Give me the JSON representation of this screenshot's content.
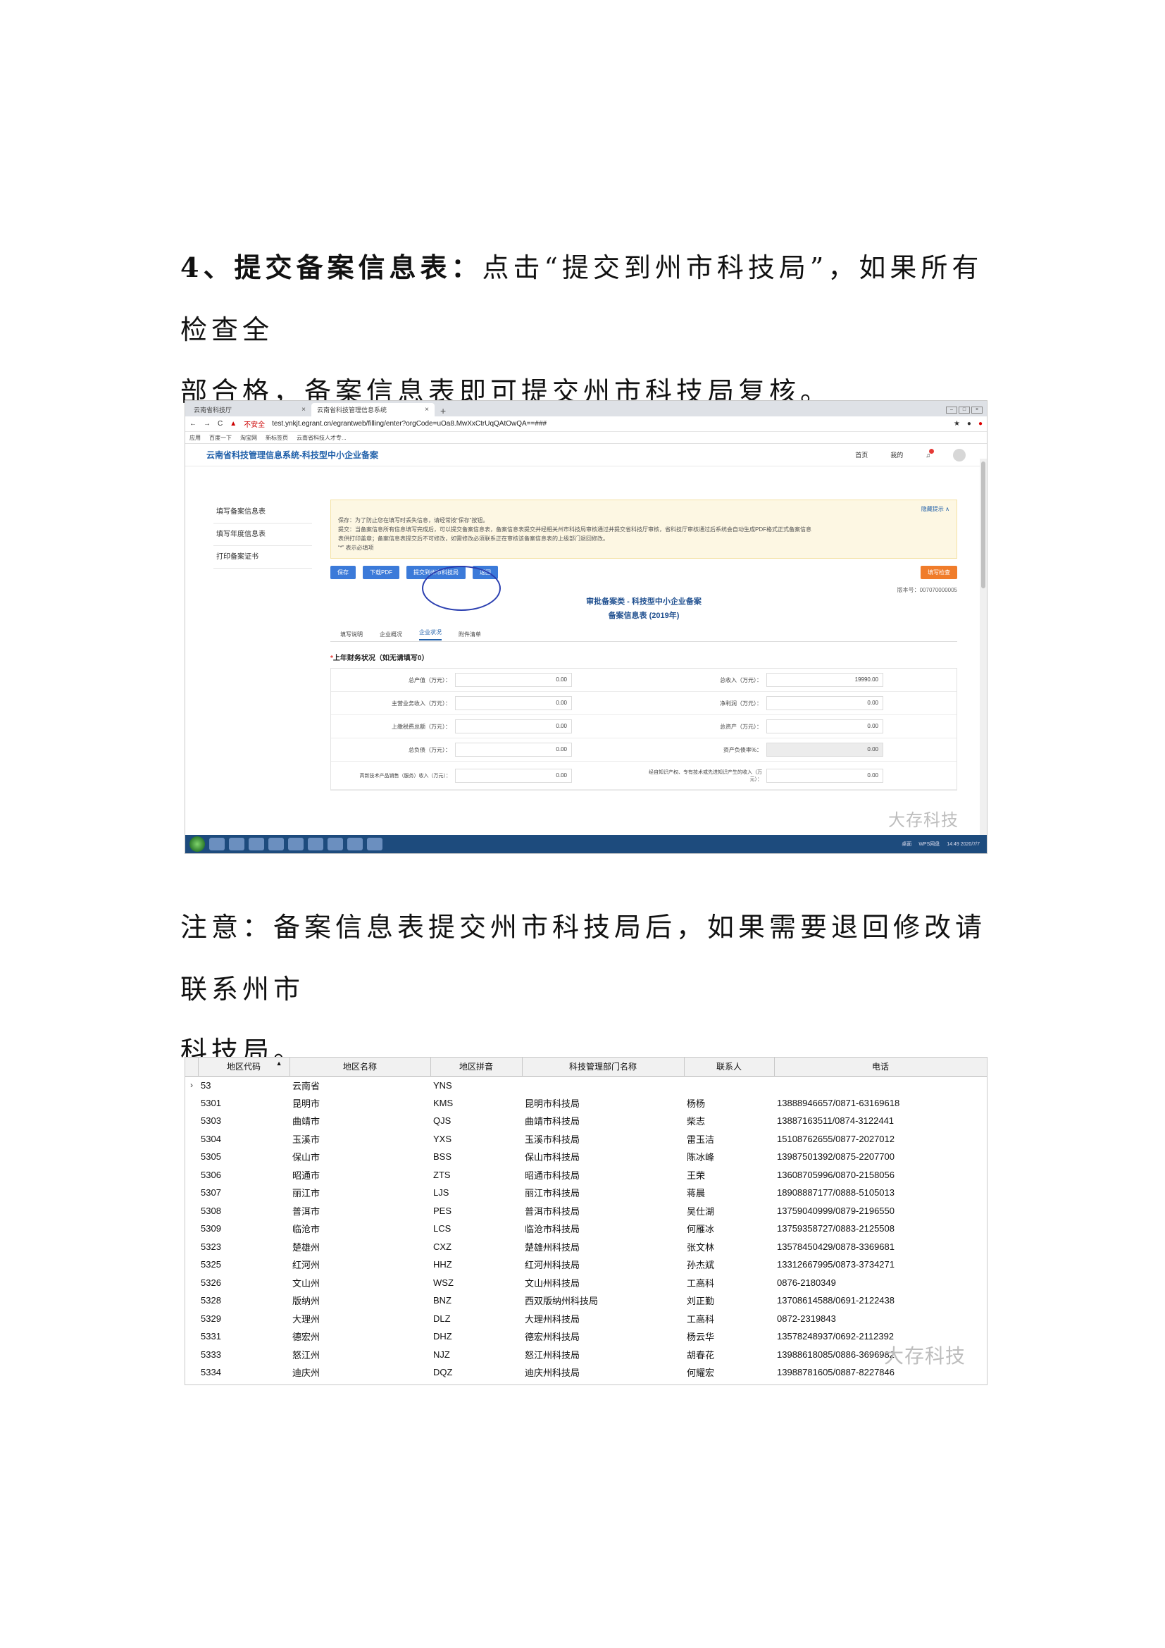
{
  "step": {
    "number": "4、",
    "title": "提交备案信息表：",
    "text_line1": "点击“提交到州市科技局”，如果所有检查全",
    "text_line2": "部合格，备案信息表即可提交州市科技局复核。"
  },
  "browser": {
    "tabs": [
      {
        "label": "云南省科技厅"
      },
      {
        "label": "云南省科技管理信息系统"
      }
    ],
    "new_tab": "+",
    "nav_icons": [
      "back-arrow-icon",
      "forward-arrow-icon",
      "reload-icon"
    ],
    "security_label": "不安全",
    "url": "test.ynkjt.egrant.cn/egrantweb/filling/enter?orgCode=uOa8.MwXxCtrUqQAtOwQA==###",
    "bookmarks": [
      "应用",
      "百度一下",
      "淘宝网",
      "新标签页",
      "云南省科技人才专..."
    ]
  },
  "app": {
    "title": "云南省科技管理信息系统-科技型中小企业备案",
    "nav": [
      "首页",
      "我的"
    ],
    "sidebar": [
      "填写备案信息表",
      "填写年度信息表",
      "打印备案证书"
    ],
    "notice": {
      "hide_link": "隐藏提示 ∧",
      "lines": [
        "保存：为了防止您在填写时丢失信息，请经常按“保存”按钮。",
        "提交：当备案信息所有信息填写完成后，可以提交备案信息表，备案信息表提交并经相关州市科技局审核通过并提交省科技厅审核，省科技厅审核通过后系统会自动生成PDF格式正式备案信息",
        "表供打印盖章；备案信息表提交后不可修改，如需修改必须联系正在审核该备案信息表的上级部门退回修改。",
        "“*” 表示必填项"
      ]
    },
    "buttons": {
      "save": "保存",
      "download": "下载PDF",
      "submit": "提交到州市科技局",
      "back": "返回",
      "check": "填写检查"
    },
    "version": "版本号：007070000005",
    "form_title_1": "审批备案类 - 科技型中小企业备案",
    "form_title_2": "备案信息表 (2019年)",
    "form_tabs": [
      "填写说明",
      "企业概况",
      "企业状况",
      "附件清单"
    ],
    "section": "上年财务状况（如无请填写0）",
    "section_req": "*",
    "fields": [
      {
        "left_label": "总产值（万元）：",
        "left_value": "0.00",
        "right_label": "总收入（万元）：",
        "right_value": "19990.00"
      },
      {
        "left_label": "主营业务收入（万元）：",
        "left_value": "0.00",
        "right_label": "净利润（万元）：",
        "right_value": "0.00"
      },
      {
        "left_label": "上缴税费总额（万元）：",
        "left_value": "0.00",
        "right_label": "总资产（万元）：",
        "right_value": "0.00"
      },
      {
        "left_label": "总负债（万元）：",
        "left_value": "0.00",
        "right_label": "资产负债率%：",
        "right_value": "0.00"
      },
      {
        "left_label": "高新技术产品销售（服务）收入（万元）：",
        "left_value": "0.00",
        "right_label": "经自知识产权、专有技术或先进知识产生的收入（万元）：",
        "right_value": "0.00"
      }
    ],
    "taskbar": {
      "tray": [
        "桌面",
        "WPS网盘"
      ],
      "time": "14:49",
      "date": "2020/7/7"
    }
  },
  "note": {
    "line1": "注意：备案信息表提交州市科技局后，如果需要退回修改请联系州市",
    "line2": "科技局。"
  },
  "region_table": {
    "headers": [
      "地区代码",
      "地区名称",
      "地区拼音",
      "科技管理部门名称",
      "联系人",
      "电话"
    ],
    "rows": [
      [
        "53",
        "云南省",
        "YNS",
        "",
        "",
        ""
      ],
      [
        "5301",
        "昆明市",
        "KMS",
        "昆明市科技局",
        "杨杨",
        "13888946657/0871-63169618"
      ],
      [
        "5303",
        "曲靖市",
        "QJS",
        "曲靖市科技局",
        "柴志",
        "13887163511/0874-3122441"
      ],
      [
        "5304",
        "玉溪市",
        "YXS",
        "玉溪市科技局",
        "雷玉洁",
        "15108762655/0877-2027012"
      ],
      [
        "5305",
        "保山市",
        "BSS",
        "保山市科技局",
        "陈冰峰",
        "13987501392/0875-2207700"
      ],
      [
        "5306",
        "昭通市",
        "ZTS",
        "昭通市科技局",
        "王荣",
        "13608705996/0870-2158056"
      ],
      [
        "5307",
        "丽江市",
        "LJS",
        "丽江市科技局",
        "蒋晨",
        "18908887177/0888-5105013"
      ],
      [
        "5308",
        "普洱市",
        "PES",
        "普洱市科技局",
        "吴仕湖",
        "13759040999/0879-2196550"
      ],
      [
        "5309",
        "临沧市",
        "LCS",
        "临沧市科技局",
        "何雁冰",
        "13759358727/0883-2125508"
      ],
      [
        "5323",
        "楚雄州",
        "CXZ",
        "楚雄州科技局",
        "张文林",
        "13578450429/0878-3369681"
      ],
      [
        "5325",
        "红河州",
        "HHZ",
        "红河州科技局",
        "孙杰斌",
        "13312667995/0873-3734271"
      ],
      [
        "5326",
        "文山州",
        "WSZ",
        "文山州科技局",
        "工高科",
        "0876-2180349"
      ],
      [
        "5328",
        "版纳州",
        "BNZ",
        "西双版纳州科技局",
        "刘正勤",
        "13708614588/0691-2122438"
      ],
      [
        "5329",
        "大理州",
        "DLZ",
        "大理州科技局",
        "工高科",
        "0872-2319843"
      ],
      [
        "5331",
        "德宏州",
        "DHZ",
        "德宏州科技局",
        "杨云华",
        "13578248937/0692-2112392"
      ],
      [
        "5333",
        "怒江州",
        "NJZ",
        "怒江州科技局",
        "胡春花",
        "13988618085/0886-3696982"
      ],
      [
        "5334",
        "迪庆州",
        "DQZ",
        "迪庆州科技局",
        "何耀宏",
        "13988781605/0887-8227846"
      ]
    ]
  },
  "watermark": "大存科技"
}
